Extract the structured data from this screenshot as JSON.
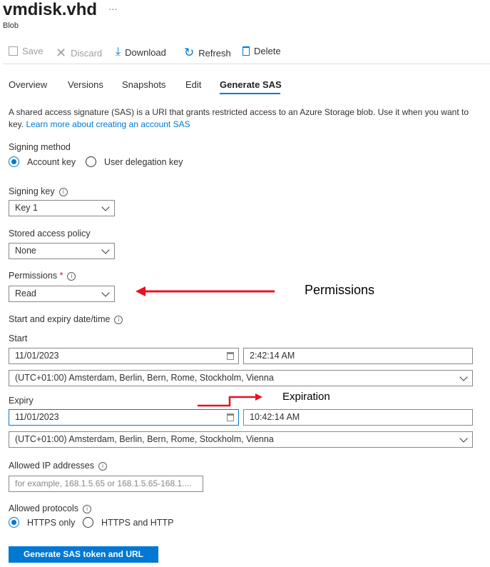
{
  "header": {
    "title": "vmdisk.vhd",
    "more": "···",
    "subtitle": "Blob"
  },
  "toolbar": {
    "save": "Save",
    "discard": "Discard",
    "download": "Download",
    "refresh": "Refresh",
    "delete": "Delete"
  },
  "tabs": [
    "Overview",
    "Versions",
    "Snapshots",
    "Edit",
    "Generate SAS"
  ],
  "active_tab": "Generate SAS",
  "description": {
    "text": "A shared access signature (SAS) is a URI that grants restricted access to an Azure Storage blob. Use it when you want to",
    "text2": "key. ",
    "link": "Learn more about creating an account SAS"
  },
  "signing_method": {
    "label": "Signing method",
    "options": [
      "Account key",
      "User delegation key"
    ],
    "selected": "Account key"
  },
  "signing_key": {
    "label": "Signing key",
    "value": "Key 1"
  },
  "stored_policy": {
    "label": "Stored access policy",
    "value": "None"
  },
  "permissions": {
    "label": "Permissions",
    "required": "*",
    "value": "Read"
  },
  "datetime": {
    "label": "Start and expiry date/time",
    "start_label": "Start",
    "start_date": "11/01/2023",
    "start_time": "2:42:14 AM",
    "start_tz": "(UTC+01:00) Amsterdam, Berlin, Bern, Rome, Stockholm, Vienna",
    "expiry_label": "Expiry",
    "expiry_date": "11/01/2023",
    "expiry_time": "10:42:14 AM",
    "expiry_tz": "(UTC+01:00) Amsterdam, Berlin, Bern, Rome, Stockholm, Vienna"
  },
  "ip": {
    "label": "Allowed IP addresses",
    "placeholder": "for example, 168.1.5.65 or 168.1.5.65-168.1...."
  },
  "protocols": {
    "label": "Allowed protocols",
    "options": [
      "HTTPS only",
      "HTTPS and HTTP"
    ],
    "selected": "HTTPS only"
  },
  "generate_button": "Generate SAS token and URL",
  "annotations": {
    "permissions": "Permissions",
    "expiration": "Expiration",
    "arrow_color": "#e81123"
  },
  "colors": {
    "accent": "#0078d4"
  }
}
